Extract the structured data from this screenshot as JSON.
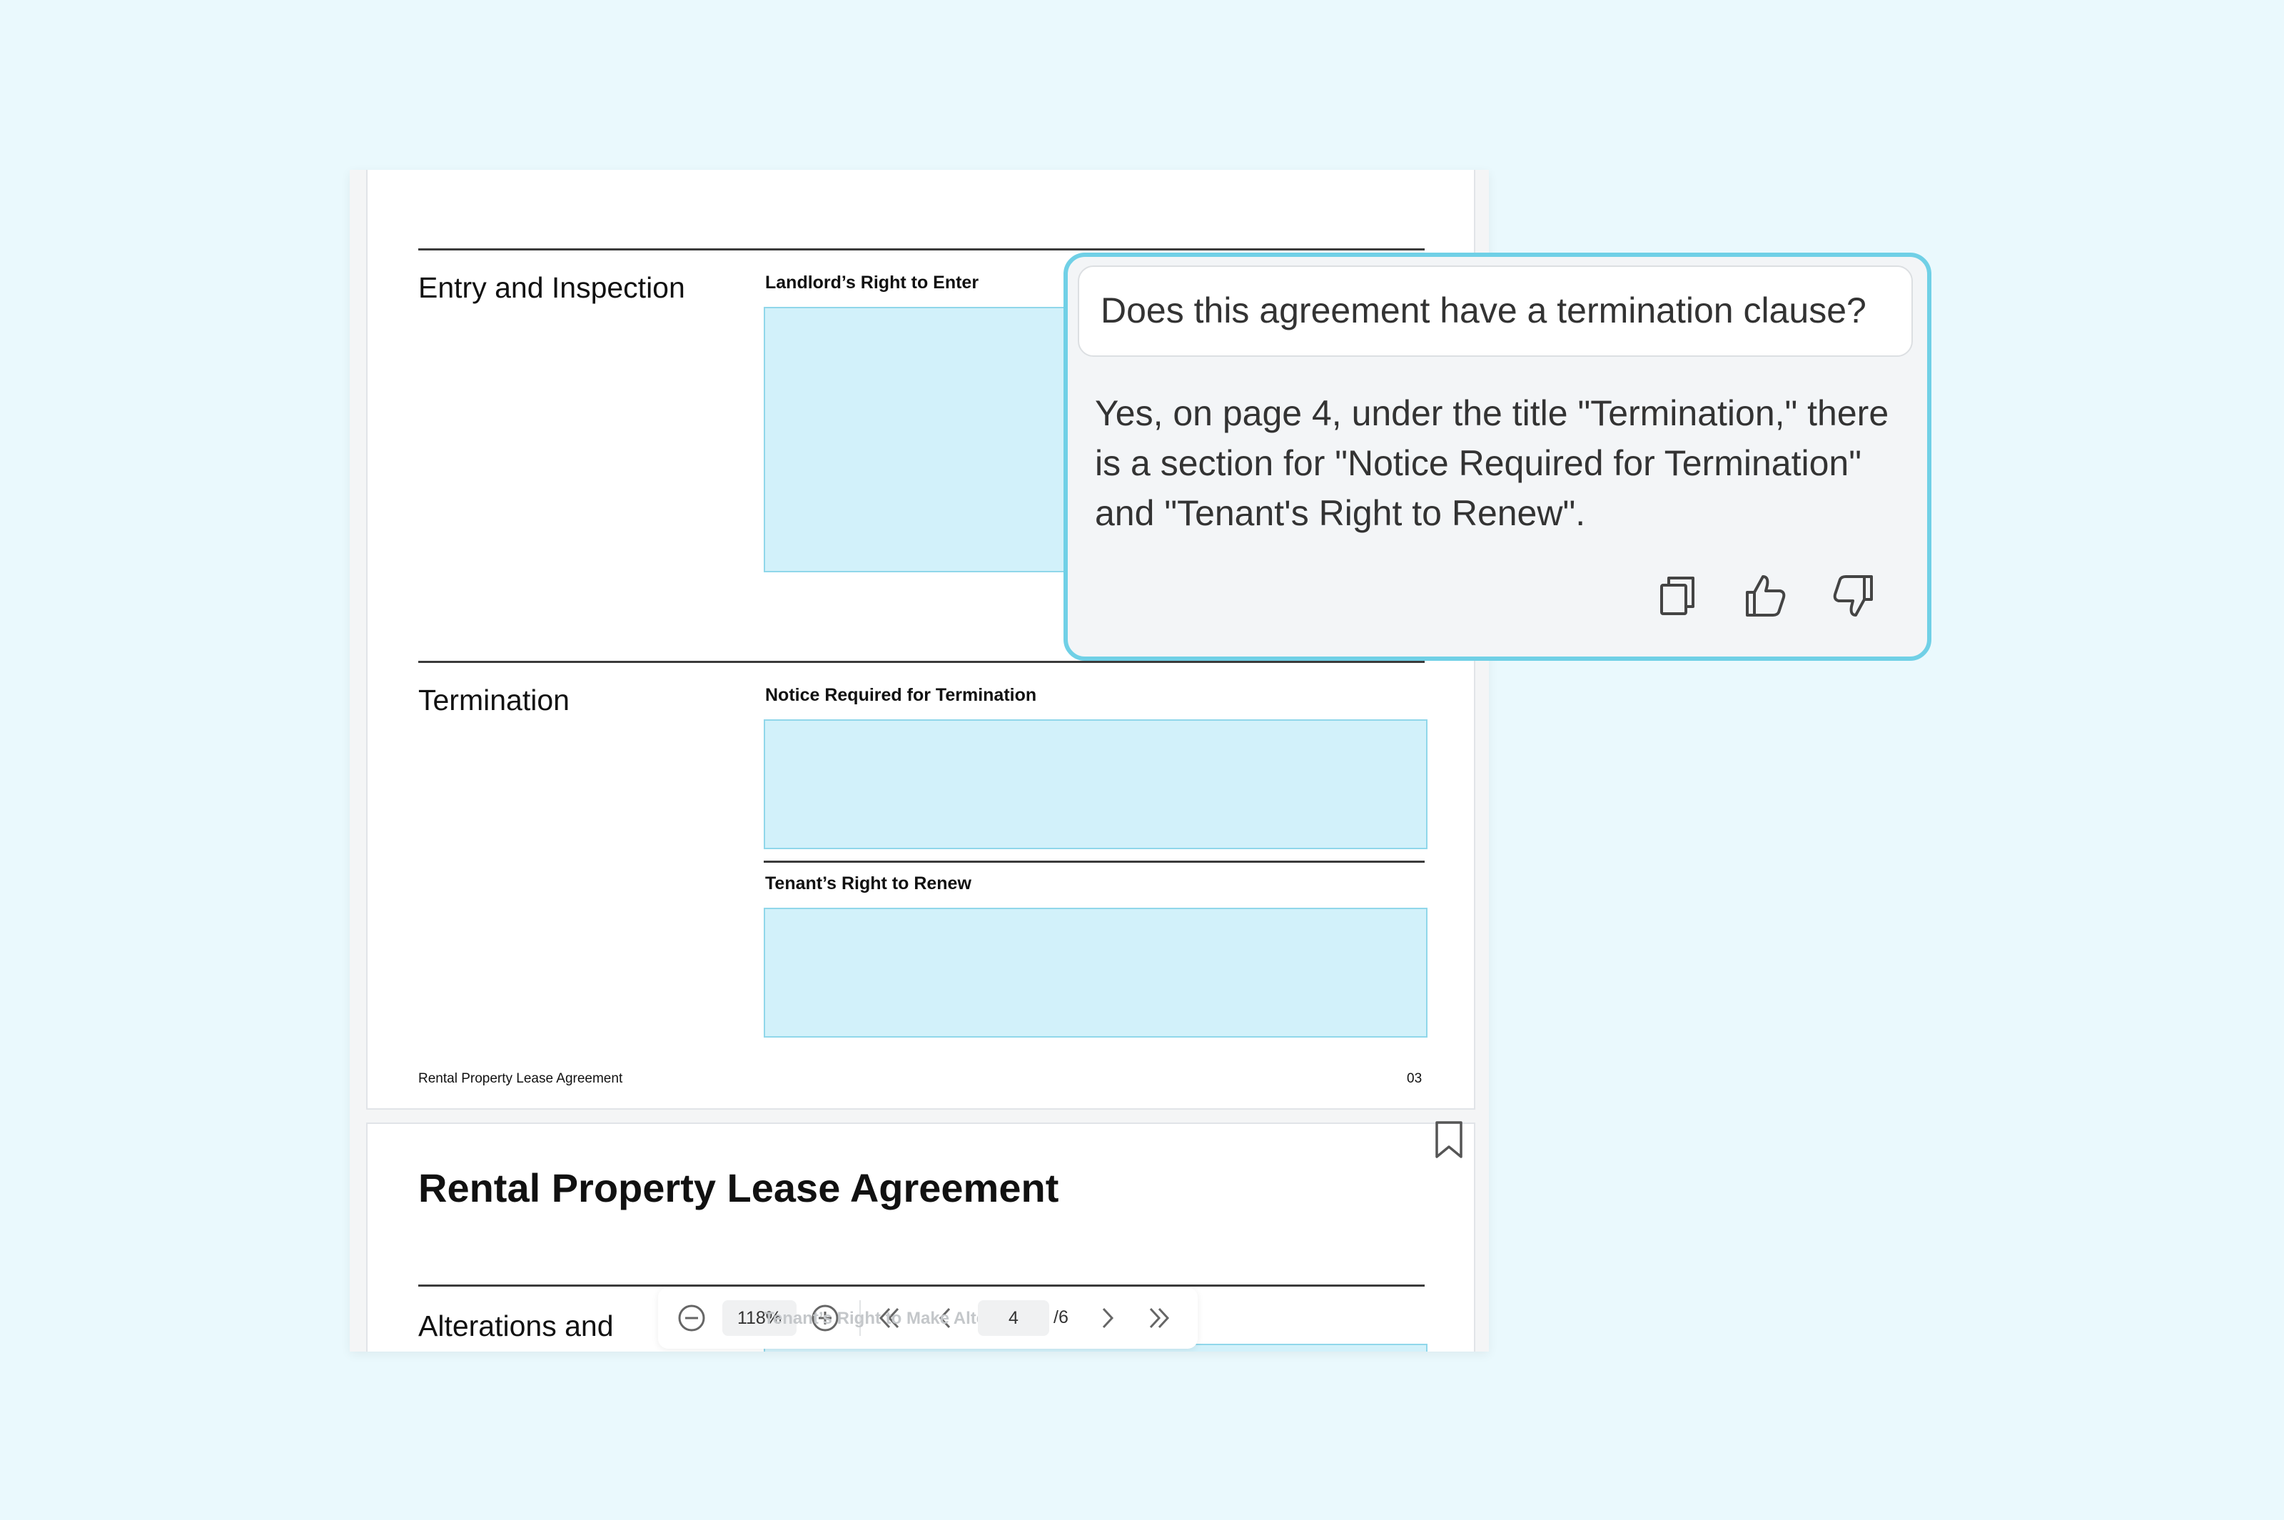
{
  "document": {
    "sections": [
      {
        "title": "Entry and Inspection",
        "fields": [
          "Landlord’s Right to Enter"
        ]
      },
      {
        "title": "Termination",
        "fields": [
          "Notice Required for Termination",
          "Tenant’s Right to Renew"
        ]
      }
    ],
    "footer": {
      "left": "Rental Property Lease Agreement",
      "right": "03"
    },
    "next_page": {
      "title": "Rental Property Lease Agreement",
      "section_title": "Alterations and",
      "field_label": "Tenant’s Right to Make Alterations"
    }
  },
  "toolbar": {
    "zoom": "118%",
    "page": "4",
    "total": "/6",
    "icons": [
      "zoom-out-icon",
      "zoom-in-icon",
      "first-page-icon",
      "prev-page-icon",
      "next-page-icon",
      "last-page-icon"
    ]
  },
  "chat": {
    "question": "Does this agreement have a termination clause?",
    "answer": "Yes, on page 4, under the title \"Termination,\" there is a section for \"Notice Required for Termination\" and \"Tenant's Right to Renew\".",
    "actions": [
      "copy-icon",
      "thumbs-up-icon",
      "thumbs-down-icon"
    ]
  },
  "colors": {
    "background": "#eaf9fd",
    "field_fill": "#d2f1fa",
    "chat_border": "#70d0e6"
  }
}
